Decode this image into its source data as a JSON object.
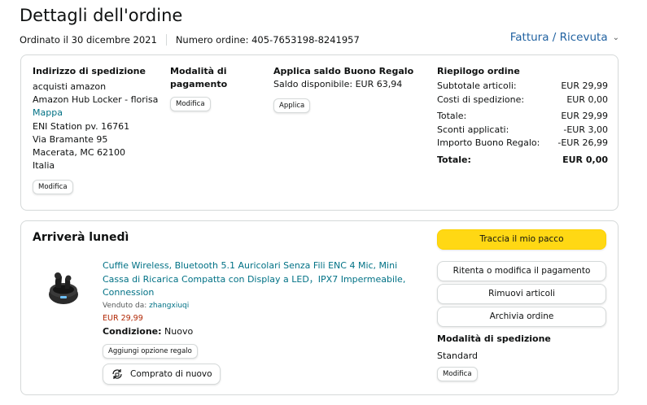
{
  "page": {
    "title": "Dettagli dell'ordine"
  },
  "meta": {
    "ordered": "Ordinato il 30 dicembre 2021",
    "order_number": "Numero ordine: 405-7653198-8241957",
    "invoice_link": "Fattura / Ricevuta"
  },
  "shipping_address": {
    "title": "Indirizzo di spedizione",
    "lines": [
      "acquisti amazon",
      "Amazon Hub Locker - florisa",
      "Mappa",
      "ENI Station pv. 16761",
      "Via Bramante 95",
      "Macerata, MC 62100",
      "Italia"
    ],
    "edit_label": "Modifica"
  },
  "payment": {
    "title_line1": "Modalità di",
    "title_line2": "pagamento",
    "edit_label": "Modifica"
  },
  "gift_card": {
    "title": "Applica saldo Buono Regalo",
    "balance": "Saldo disponibile: EUR 63,94",
    "apply_label": "Applica"
  },
  "summary": {
    "title": "Riepilogo ordine",
    "rows": [
      {
        "label": "Subtotale articoli:",
        "value": "EUR 29,99"
      },
      {
        "label": "Costi di spedizione:",
        "value": "EUR 0,00"
      },
      {
        "label": "Totale:",
        "value": "EUR 29,99"
      },
      {
        "label": "Sconti applicati:",
        "value": "-EUR 3,00"
      },
      {
        "label": "Importo Buono Regalo:",
        "value": "-EUR 26,99"
      }
    ],
    "grand_total_label": "Totale:",
    "grand_total_value": "EUR 0,00"
  },
  "shipment": {
    "arrival": "Arriverà lunedì",
    "product_title": "Cuffie Wireless, Bluetooth 5.1 Auricolari Senza Fili ENC 4 Mic, Mini Cassa di Ricarica Compatta con Display a LED，IPX7 Impermeabile, Connession",
    "seller_label": "Venduto da:",
    "seller_name": "zhangxiuqi",
    "price": "EUR 29,99",
    "condition_label": "Condizione:",
    "condition_value": "Nuovo",
    "gift_option_label": "Aggiungi opzione regalo",
    "buy_again_label": "Comprato di nuovo"
  },
  "actions": {
    "track": "Traccia il mio pacco",
    "payment": "Ritenta o modifica il pagamento",
    "remove": "Rimuovi articoli",
    "archive": "Archivia ordine"
  },
  "shipping_method": {
    "title": "Modalità di spedizione",
    "value": "Standard",
    "edit_label": "Modifica"
  },
  "colors": {
    "link": "#007185",
    "primary_button": "#ffd814",
    "price": "#b12704"
  }
}
